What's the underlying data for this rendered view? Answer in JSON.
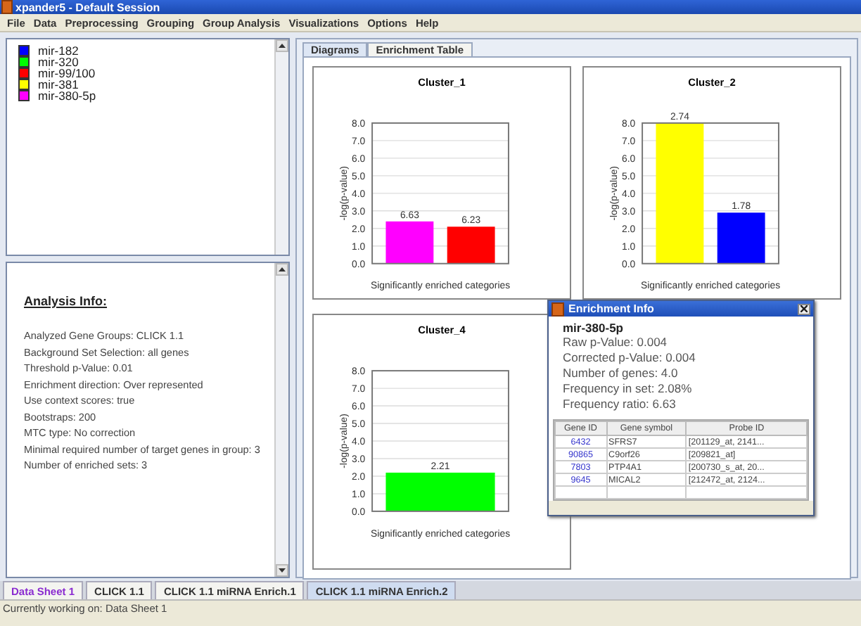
{
  "window": {
    "title": "xpander5 - Default Session"
  },
  "menu": [
    "File",
    "Data",
    "Preprocessing",
    "Grouping",
    "Group Analysis",
    "Visualizations",
    "Options",
    "Help"
  ],
  "legend": [
    {
      "label": "mir-182",
      "color": "#0000ff"
    },
    {
      "label": "mir-320",
      "color": "#00ff00"
    },
    {
      "label": "mir-99/100",
      "color": "#ff0000"
    },
    {
      "label": "mir-381",
      "color": "#ffff00"
    },
    {
      "label": "mir-380-5p",
      "color": "#ff00ff"
    }
  ],
  "analysis_info": {
    "heading": "Analysis Info:",
    "lines": [
      "Analyzed Gene Groups: CLICK 1.1",
      "Background Set Selection: all genes",
      "Threshold p-Value: 0.01",
      "Enrichment direction: Over represented",
      "Use context scores: true",
      "Bootstraps: 200",
      "MTC type: No correction",
      "Minimal required number of target genes in group:  3",
      "Number of enriched sets: 3"
    ]
  },
  "view_tabs": [
    {
      "label": "Diagrams",
      "selected": true
    },
    {
      "label": "Enrichment Table",
      "selected": false
    }
  ],
  "charts": [
    {
      "chart_data": {
        "type": "bar",
        "title": "Cluster_1",
        "xlabel": "Significantly enriched categories",
        "ylabel": "-log(p-value)",
        "ylim": [
          0,
          8
        ],
        "yticks": [
          {
            "value": 0,
            "label": "0.0"
          },
          {
            "value": 1,
            "label": "1.0"
          },
          {
            "value": 2,
            "label": "2.0"
          },
          {
            "value": 3,
            "label": "3.0"
          },
          {
            "value": 4,
            "label": "4.0"
          },
          {
            "value": 5,
            "label": "5.0"
          },
          {
            "value": 6,
            "label": "6.0"
          },
          {
            "value": 7,
            "label": "7.0"
          },
          {
            "value": 8,
            "label": "8.0"
          }
        ],
        "series": [
          {
            "color": "#ff00ff",
            "values": [
              2.4
            ]
          },
          {
            "color": "#ff0000",
            "values": [
              2.1
            ]
          }
        ],
        "value_labels": [
          "6.63",
          "6.23"
        ],
        "grid": true
      }
    },
    {
      "chart_data": {
        "type": "bar",
        "title": "Cluster_2",
        "xlabel": "Significantly enriched categories",
        "ylabel": "-log(p-value)",
        "ylim": [
          0,
          8
        ],
        "yticks": [
          {
            "value": 0,
            "label": "0.0"
          },
          {
            "value": 1,
            "label": "1.0"
          },
          {
            "value": 2,
            "label": "2.0"
          },
          {
            "value": 3,
            "label": "3.0"
          },
          {
            "value": 4,
            "label": "4.0"
          },
          {
            "value": 5,
            "label": "5.0"
          },
          {
            "value": 6,
            "label": "6.0"
          },
          {
            "value": 7,
            "label": "7.0"
          },
          {
            "value": 8,
            "label": "8.0"
          }
        ],
        "series": [
          {
            "color": "#ffff00",
            "values": [
              8.0
            ]
          },
          {
            "color": "#0000ff",
            "values": [
              2.9
            ]
          }
        ],
        "value_labels": [
          "2.74",
          "1.78"
        ],
        "grid": true
      }
    },
    {
      "chart_data": {
        "type": "bar",
        "title": "Cluster_4",
        "xlabel": "Significantly enriched categories",
        "ylabel": "-log(p-value)",
        "ylim": [
          0,
          8
        ],
        "yticks": [
          {
            "value": 0,
            "label": "0.0"
          },
          {
            "value": 1,
            "label": "1.0"
          },
          {
            "value": 2,
            "label": "2.0"
          },
          {
            "value": 3,
            "label": "3.0"
          },
          {
            "value": 4,
            "label": "4.0"
          },
          {
            "value": 5,
            "label": "5.0"
          },
          {
            "value": 6,
            "label": "6.0"
          },
          {
            "value": 7,
            "label": "7.0"
          },
          {
            "value": 8,
            "label": "8.0"
          }
        ],
        "series": [
          {
            "color": "#00ff00",
            "values": [
              2.2
            ]
          }
        ],
        "value_labels": [
          "2.21"
        ],
        "grid": true
      }
    }
  ],
  "enrichment_info": {
    "title": "Enrichment Info",
    "name": "mir-380-5p",
    "details": [
      "Raw p-Value: 0.004",
      "Corrected p-Value: 0.004",
      "Number of genes: 4.0",
      "Frequency in set: 2.08%",
      "Frequency ratio: 6.63"
    ],
    "table": {
      "columns": [
        "Gene ID",
        "Gene symbol",
        "Probe ID"
      ],
      "rows": [
        [
          "6432",
          "SFRS7",
          "[201129_at, 2141..."
        ],
        [
          "90865",
          "C9orf26",
          "[209821_at]"
        ],
        [
          "7803",
          "PTP4A1",
          "[200730_s_at, 20..."
        ],
        [
          "9645",
          "MICAL2",
          "[212472_at, 2124..."
        ]
      ]
    }
  },
  "sheet_tabs": [
    {
      "label": "Data Sheet 1",
      "kind": "data",
      "selected": false
    },
    {
      "label": "CLICK 1.1",
      "kind": "analysis",
      "selected": false
    },
    {
      "label": "CLICK 1.1 miRNA Enrich.1",
      "kind": "analysis",
      "selected": false
    },
    {
      "label": "CLICK 1.1 miRNA Enrich.2",
      "kind": "analysis",
      "selected": true
    }
  ],
  "status_bar": "Currently working on: Data Sheet 1"
}
